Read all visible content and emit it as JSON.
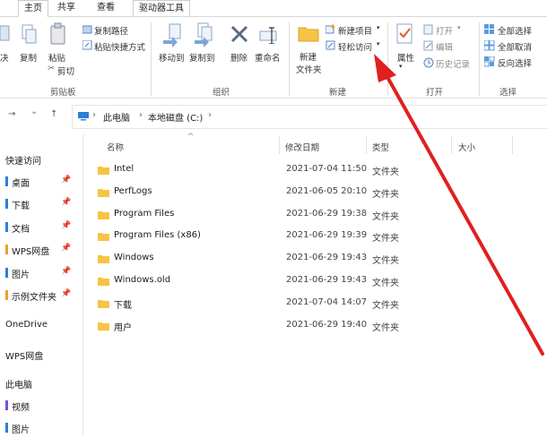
{
  "tabs": [
    "主页",
    "共享",
    "查看",
    "驱动器工具"
  ],
  "ribbon": {
    "clipboard": {
      "cut_partial": "决",
      "copy": "复制",
      "paste": "粘贴",
      "copy_path": "复制路径",
      "paste_shortcut": "粘贴快捷方式",
      "cut": "剪切",
      "group": "剪贴板"
    },
    "organize": {
      "move_to": "移动到",
      "copy_to": "复制到",
      "delete": "删除",
      "rename": "重命名",
      "group": "组织"
    },
    "new": {
      "new_folder_line1": "新建",
      "new_folder_line2": "文件夹",
      "new_item": "新建项目",
      "easy_access": "轻松访问",
      "group": "新建"
    },
    "open": {
      "properties": "属性",
      "open": "打开",
      "edit": "编辑",
      "history": "历史记录",
      "group": "打开"
    },
    "select": {
      "select_all": "全部选择",
      "select_none": "全部取消",
      "invert": "反向选择",
      "group": "选择"
    }
  },
  "address": {
    "back": "→",
    "dropdown": "⌄",
    "up": "↑",
    "crumbs": [
      "此电脑",
      "本地磁盘 (C:)"
    ],
    "sep": "›"
  },
  "columns": {
    "name": "名称",
    "date": "修改日期",
    "type": "类型",
    "size": "大小",
    "sort_arrow": "^"
  },
  "files": [
    {
      "name": "Intel",
      "date": "2021-07-04 11:50",
      "type": "文件夹"
    },
    {
      "name": "PerfLogs",
      "date": "2021-06-05 20:10",
      "type": "文件夹"
    },
    {
      "name": "Program Files",
      "date": "2021-06-29 19:38",
      "type": "文件夹"
    },
    {
      "name": "Program Files (x86)",
      "date": "2021-06-29 19:39",
      "type": "文件夹"
    },
    {
      "name": "Windows",
      "date": "2021-06-29 19:43",
      "type": "文件夹"
    },
    {
      "name": "Windows.old",
      "date": "2021-06-29 19:43",
      "type": "文件夹"
    },
    {
      "name": "下载",
      "date": "2021-07-04 14:07",
      "type": "文件夹"
    },
    {
      "name": "用户",
      "date": "2021-06-29 19:40",
      "type": "文件夹"
    }
  ],
  "nav": {
    "quick_access": "快速访问",
    "quick_items": [
      {
        "label": "桌面",
        "color": "#2b7fd4"
      },
      {
        "label": "下载",
        "color": "#2b7fd4"
      },
      {
        "label": "文档",
        "color": "#2b7fd4"
      },
      {
        "label": "WPS网盘",
        "color": "#e8a32b"
      },
      {
        "label": "图片",
        "color": "#2b7fd4"
      },
      {
        "label": "示例文件夹",
        "color": "#e8a32b"
      }
    ],
    "onedrive": "OneDrive",
    "wps": "WPS网盘",
    "this_pc": "此电脑",
    "pc_items": [
      {
        "label": "视频",
        "color": "#7b4fd4"
      },
      {
        "label": "图片",
        "color": "#2b7fd4"
      }
    ]
  },
  "colors": {
    "folder": "#f6c445",
    "arrow": "#e02020",
    "accent": "#2b7fd4"
  }
}
